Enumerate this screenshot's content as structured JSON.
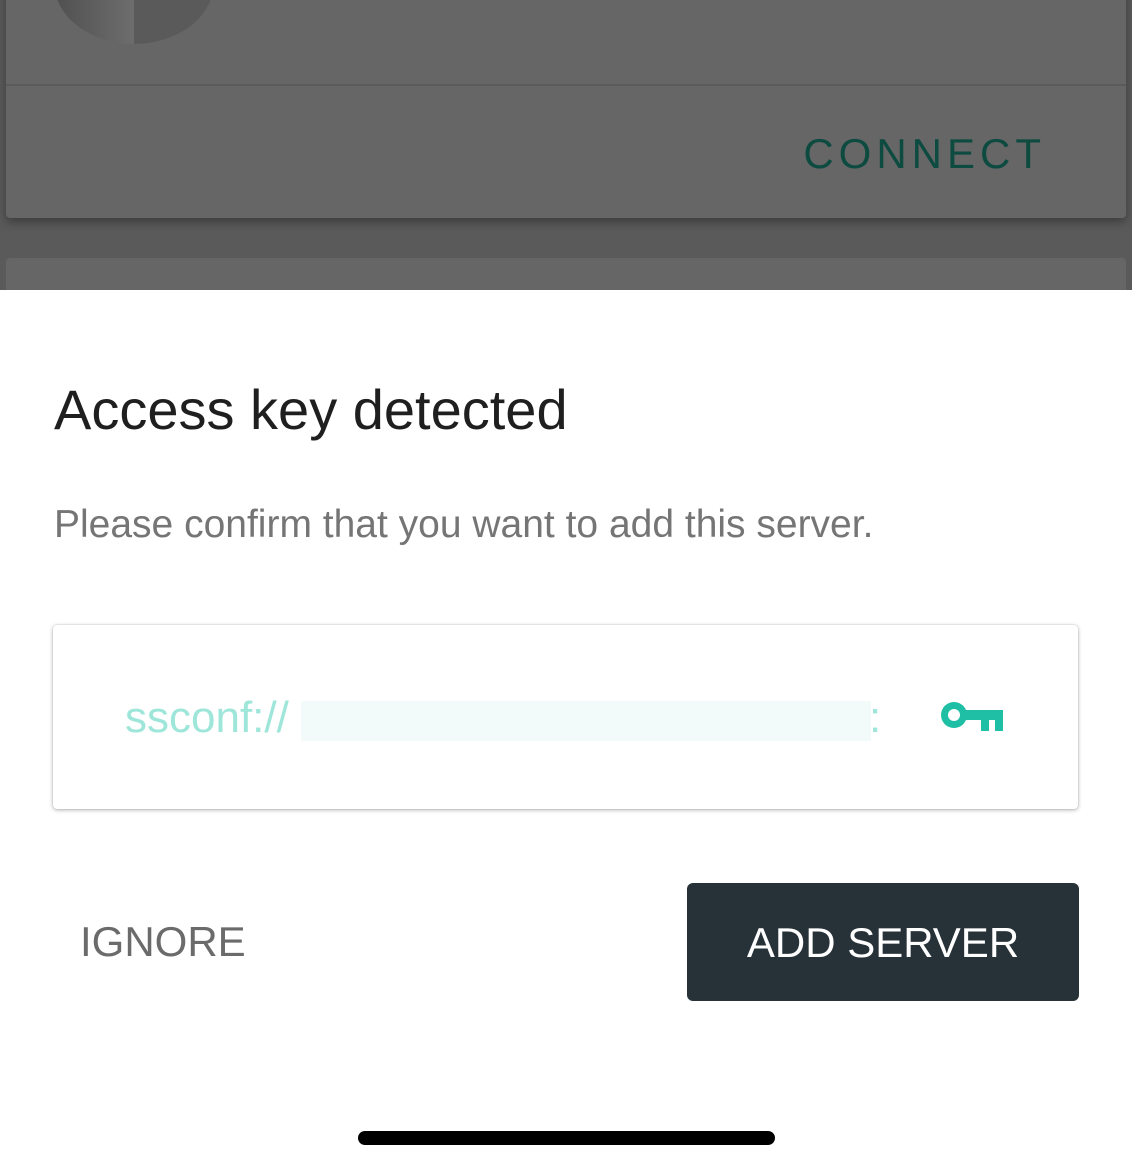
{
  "background": {
    "connect_label": "CONNECT"
  },
  "dialog": {
    "title": "Access key detected",
    "message": "Please confirm that you want to add this server.",
    "access_key": {
      "prefix": "ssconf://",
      "suffix": ":",
      "icon": "key-icon"
    },
    "ignore_label": "IGNORE",
    "add_server_label": "ADD SERVER"
  },
  "colors": {
    "accent": "#1fbfa5",
    "primary_button": "#263238",
    "overlay": "#5a5a5a",
    "connect_text": "#0d4a40"
  }
}
